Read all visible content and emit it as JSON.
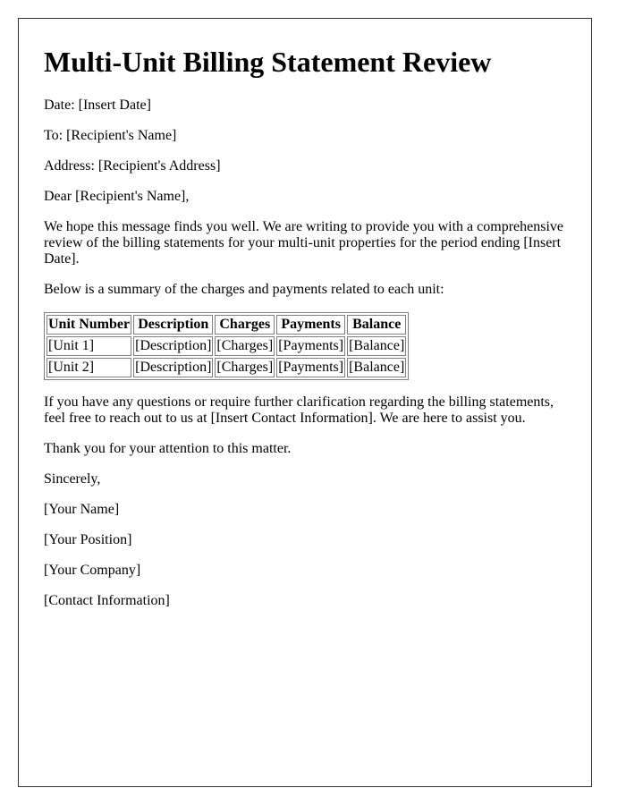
{
  "document": {
    "title": "Multi-Unit Billing Statement Review",
    "date_line": "Date: [Insert Date]",
    "to_line": "To: [Recipient's Name]",
    "address_line": "Address: [Recipient's Address]",
    "salutation": "Dear [Recipient's Name],",
    "intro_paragraph": "We hope this message finds you well. We are writing to provide you with a comprehensive review of the billing statements for your multi-unit properties for the period ending [Insert Date].",
    "summary_intro": "Below is a summary of the charges and payments related to each unit:",
    "table": {
      "headers": [
        "Unit Number",
        "Description",
        "Charges",
        "Payments",
        "Balance"
      ],
      "rows": [
        [
          "[Unit 1]",
          "[Description]",
          "[Charges]",
          "[Payments]",
          "[Balance]"
        ],
        [
          "[Unit 2]",
          "[Description]",
          "[Charges]",
          "[Payments]",
          "[Balance]"
        ]
      ]
    },
    "questions_paragraph": "If you have any questions or require further clarification regarding the billing statements, feel free to reach out to us at [Insert Contact Information]. We are here to assist you.",
    "thanks_line": "Thank you for your attention to this matter.",
    "closing": "Sincerely,",
    "signature": {
      "name": "[Your Name]",
      "position": "[Your Position]",
      "company": "[Your Company]",
      "contact": "[Contact Information]"
    }
  }
}
